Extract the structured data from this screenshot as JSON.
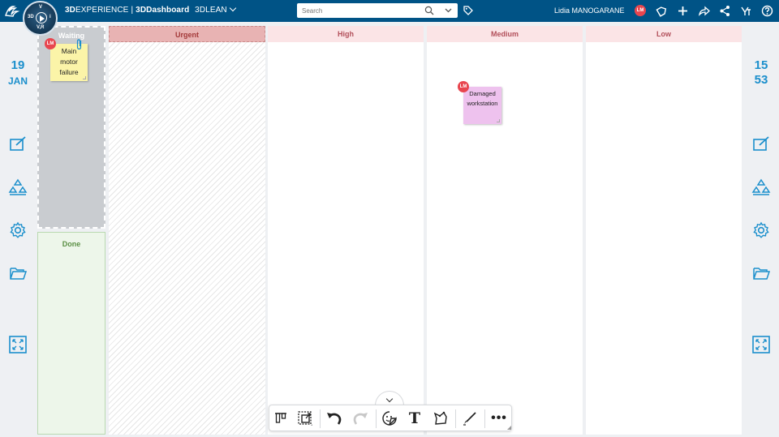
{
  "topbar": {
    "brand_bold": "3D",
    "brand_rest": "EXPERIENCE",
    "separator": "|",
    "dashboard_bold": "3D",
    "dashboard_rest": "Dashboard",
    "app_name": "3DLEAN",
    "compass_v": "V",
    "compass_3d": "3D",
    "compass_i": "i",
    "compass_vr": "V,R",
    "search_placeholder": "Search",
    "user_name": "Lidia MANOGARANE",
    "user_initials": "LM"
  },
  "left_panel": {
    "day": "19",
    "month": "JAN"
  },
  "right_panel": {
    "hour": "15",
    "minute": "53"
  },
  "board": {
    "columns": [
      {
        "id": "waiting",
        "label": "Waiting"
      },
      {
        "id": "done",
        "label": "Done"
      },
      {
        "id": "urgent",
        "label": "Urgent"
      },
      {
        "id": "high",
        "label": "High"
      },
      {
        "id": "medium",
        "label": "Medium"
      },
      {
        "id": "low",
        "label": "Low"
      }
    ],
    "notes": [
      {
        "column": "waiting",
        "line1": "Main",
        "line2": "motor",
        "line3": "failure",
        "author": "LM",
        "color": "#fbf4a8"
      },
      {
        "column": "medium",
        "line1": "Damaged",
        "line2": "workstation",
        "author": "LM",
        "color": "#eec2ee"
      }
    ]
  },
  "toolbar": {
    "text_tool": "T",
    "more_tool": "•••"
  },
  "colors": {
    "topbar": "#005386",
    "accent": "#1b8fcc",
    "avatar": "#e8464f"
  }
}
